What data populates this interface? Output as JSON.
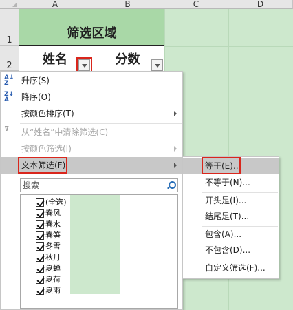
{
  "columns": [
    "A",
    "B",
    "C",
    "D"
  ],
  "rows": [
    "1",
    "2"
  ],
  "cells": {
    "title": "筛选区域",
    "header_name": "姓名",
    "header_score": "分数"
  },
  "filter_menu": {
    "items": [
      {
        "label": "升序(S)",
        "icon": "sort-ascending-icon",
        "disabled": false
      },
      {
        "label": "降序(O)",
        "icon": "sort-descending-icon",
        "disabled": false
      },
      {
        "label": "按颜色排序(T)",
        "submenu": true,
        "disabled": false
      },
      {
        "label": "从“姓名”中清除筛选(C)",
        "icon": "clear-filter-icon",
        "disabled": true
      },
      {
        "label": "按颜色筛选(I)",
        "submenu": true,
        "disabled": true
      },
      {
        "label": "文本筛选(F)",
        "submenu": true,
        "disabled": false,
        "highlighted": true
      }
    ],
    "search_placeholder": "搜索",
    "list": [
      "(全选)",
      "春风",
      "春水",
      "春笋",
      "冬雪",
      "秋月",
      "夏蝉",
      "夏荷",
      "夏雨"
    ]
  },
  "text_filter_submenu": {
    "items": [
      "等于(E)...",
      "不等于(N)...",
      "开头是(I)...",
      "结尾是(T)...",
      "包含(A)...",
      "不包含(D)...",
      "自定义筛选(F)..."
    ],
    "highlighted_index": 0
  },
  "colors": {
    "sheet_bg": "#cde8cd",
    "title_bg": "#a9d8a7",
    "highlight_box": "#d9261c",
    "menu_hover": "#c8c8c8"
  }
}
